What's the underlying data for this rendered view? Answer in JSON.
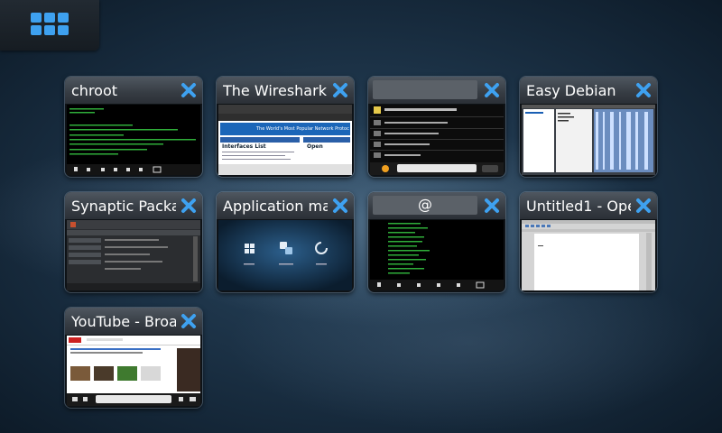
{
  "launcher": {
    "icon": "app-grid-icon",
    "accent": "#3ea1f0"
  },
  "close_icon": {
    "name": "close-x-icon",
    "color": "#3ea1f0"
  },
  "windows": [
    {
      "title": "chroot"
    },
    {
      "title": "The Wireshark",
      "content": {
        "banner": "The World's Most Popular Network Protoc",
        "left_heading": "Interfaces List",
        "right_heading": "Open"
      }
    },
    {
      "title": ""
    },
    {
      "title": "Easy Debian"
    },
    {
      "title": "Synaptic Packa"
    },
    {
      "title": "Application ma"
    },
    {
      "title": "@"
    },
    {
      "title": "Untitled1 - Ope"
    },
    {
      "title": "YouTube - Broa"
    }
  ]
}
